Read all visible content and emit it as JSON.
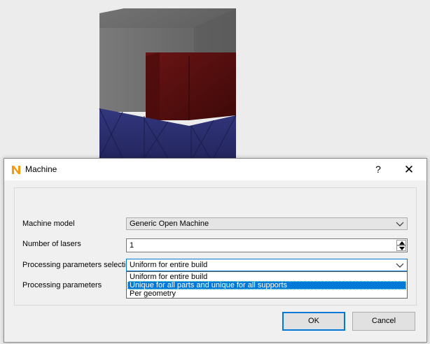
{
  "dialog": {
    "title": "Machine",
    "help_label": "?",
    "close_label": "✕"
  },
  "form": {
    "machine_model_label": "Machine model",
    "machine_model_value": "Generic Open Machine",
    "num_lasers_label": "Number of lasers",
    "num_lasers_value": "1",
    "pps_label": "Processing parameters selection",
    "pps_value": "Uniform for entire build",
    "pp_label": "Processing parameters"
  },
  "dropdown": {
    "options": [
      "Uniform for entire build",
      "Unique for all parts and unique for all supports",
      "Per geometry"
    ],
    "selected_index": 1
  },
  "buttons": {
    "ok": "OK",
    "cancel": "Cancel"
  },
  "colors": {
    "accent": "#0078d7",
    "part_gray": "#6b6b6b",
    "part_red": "#5a0f0f",
    "support_blue": "#2d2f73"
  }
}
